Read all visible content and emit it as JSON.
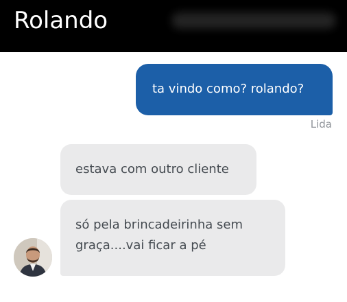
{
  "header": {
    "title": "Rolando"
  },
  "messages": [
    {
      "direction": "outgoing",
      "text": "ta vindo como? rolando?",
      "status": "Lida"
    },
    {
      "direction": "incoming",
      "lines": [
        "estava com outro cliente"
      ]
    },
    {
      "direction": "incoming",
      "lines": [
        "só pela brincadeirinha sem",
        "graça....vai ficar a pé"
      ]
    }
  ],
  "colors": {
    "header": "#000000",
    "outgoing_bubble": "#1c5fa8",
    "incoming_bubble": "#eaeaeb"
  },
  "avatar": {
    "icon": "person-photo"
  }
}
